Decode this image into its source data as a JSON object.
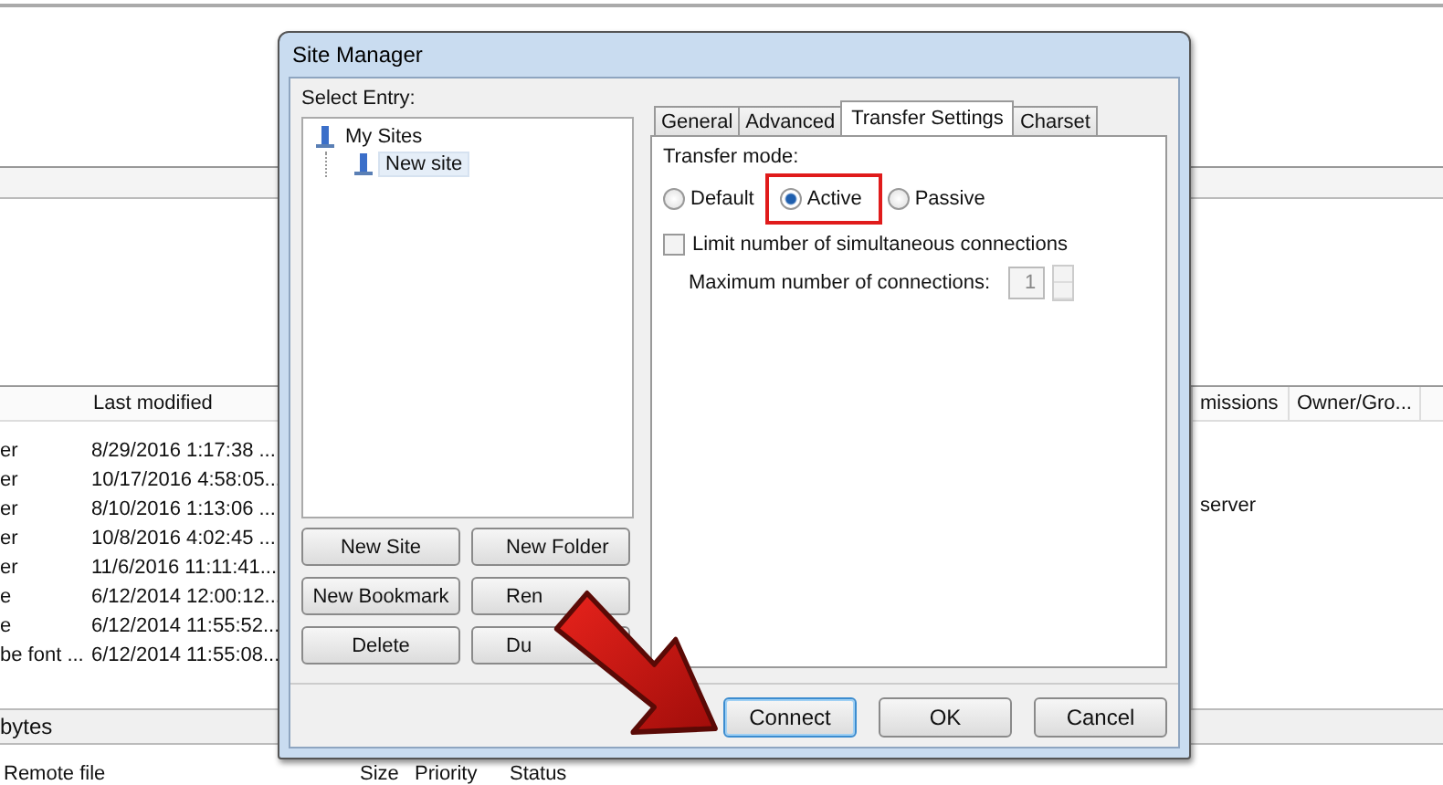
{
  "background_app": {
    "local_list": {
      "columns": [
        "Last modified"
      ],
      "rows": [
        {
          "name": "er",
          "modified": "8/29/2016 1:17:38 ..."
        },
        {
          "name": "er",
          "modified": "10/17/2016 4:58:05..."
        },
        {
          "name": "er",
          "modified": "8/10/2016 1:13:06 ..."
        },
        {
          "name": "er",
          "modified": "10/8/2016 4:02:45 ..."
        },
        {
          "name": "er",
          "modified": "11/6/2016 11:11:41..."
        },
        {
          "name": "e",
          "modified": "6/12/2014 12:00:12..."
        },
        {
          "name": "e",
          "modified": "6/12/2014 11:55:52..."
        },
        {
          "name": "be font ...",
          "modified": "6/12/2014 11:55:08..."
        }
      ]
    },
    "remote_list": {
      "columns": [
        "missions",
        "Owner/Gro..."
      ],
      "rows": [
        "server"
      ]
    },
    "status": "bytes",
    "queue_columns": [
      "Remote file",
      "Size",
      "Priority",
      "Status"
    ]
  },
  "dialog": {
    "title": "Site Manager",
    "select_label": "Select Entry:",
    "tree": [
      {
        "label": "My Sites",
        "selected": false,
        "children": [
          {
            "label": "New site",
            "selected": true
          }
        ]
      }
    ],
    "entry_buttons": [
      "New Site",
      "New Folder",
      "New Bookmark",
      "Ren",
      "Delete",
      "Du"
    ],
    "tabs": [
      {
        "label": "General",
        "selected": false
      },
      {
        "label": "Advanced",
        "selected": false
      },
      {
        "label": "Transfer Settings",
        "selected": true
      },
      {
        "label": "Charset",
        "selected": false
      }
    ],
    "transfer_mode_label": "Transfer mode:",
    "modes": [
      {
        "label": "Default",
        "selected": false
      },
      {
        "label": "Active",
        "selected": true
      },
      {
        "label": "Passive",
        "selected": false
      }
    ],
    "limit": {
      "label": "Limit number of simultaneous connections",
      "checked": false
    },
    "max_connections": {
      "label": "Maximum number of connections:",
      "value": "1",
      "disabled": true
    },
    "buttons": [
      {
        "label": "Connect",
        "default": true
      },
      {
        "label": "OK",
        "default": false
      },
      {
        "label": "Cancel",
        "default": false
      }
    ]
  }
}
